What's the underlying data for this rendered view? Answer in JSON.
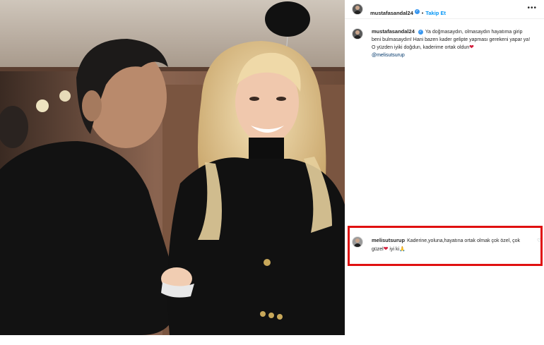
{
  "post": {
    "author": "mustafasandal24",
    "follow_label": "Takip Et",
    "separator": "•",
    "more_label": "•••"
  },
  "caption": {
    "author": "mustafasandal24",
    "text": "Ya doğmasaydın, olmasaydın hayatıma girip beni bulmasaydın! Hani bazen kader gelipte yapması gerekeni yapar ya! O yüzden iyiki doğdun, kaderime ortak oldun",
    "heart": "❤",
    "mention": "@melisutsurup"
  },
  "comment": {
    "author": "melisutsurup",
    "text": "Kaderine,yoluna,hayatına ortak olmak çok özel, çok güzel",
    "heart": "❤",
    "text2": "iyi ki",
    "emoji": "🙏",
    "like_icon": "♡"
  },
  "colors": {
    "highlight_box": "#e01010",
    "link": "#0095f6",
    "heart": "#d21f3c"
  },
  "icons": [
    "verified-badge-icon",
    "more-options-icon",
    "heart-like-icon",
    "balloon-decoration"
  ]
}
